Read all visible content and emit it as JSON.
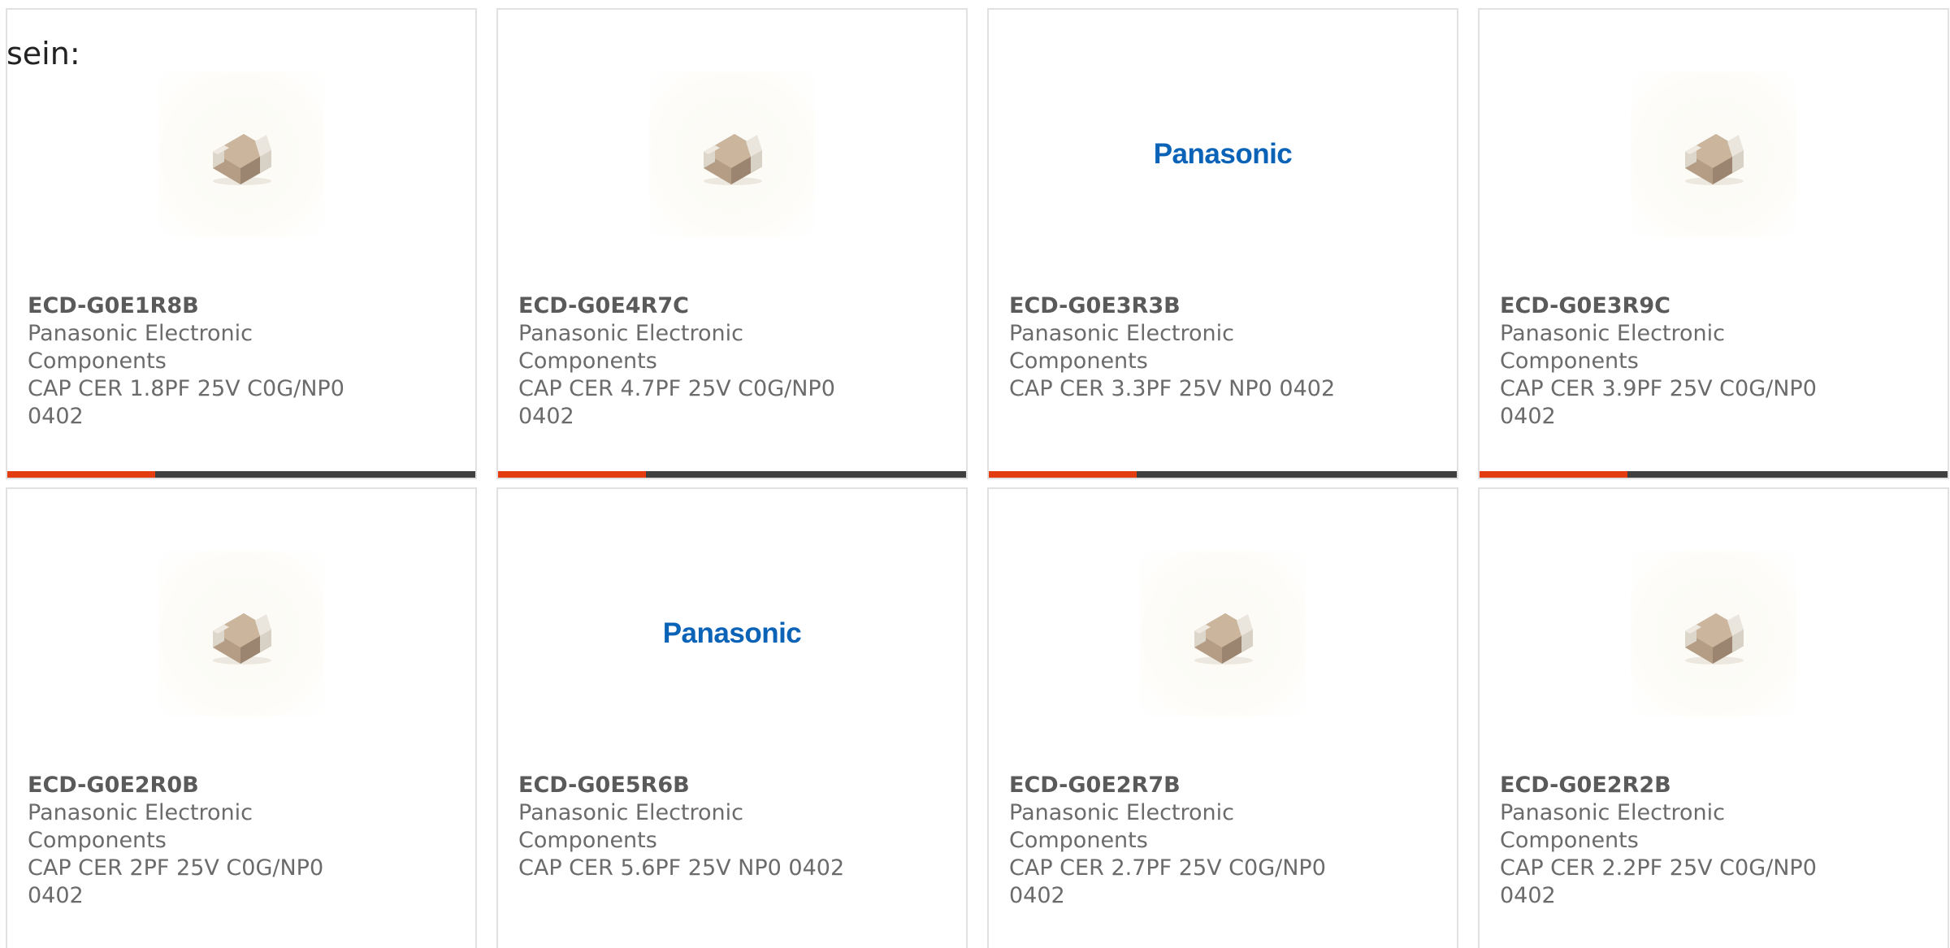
{
  "page": {
    "lead_text": "sein:"
  },
  "colors": {
    "accent": "#e33c10",
    "bar_dark": "#404040",
    "brand_blue": "#0a63b7",
    "text_gray": "#6b6b6b",
    "card_border": "#e1e1e1"
  },
  "products": [
    {
      "part_number": "ECD-G0E1R8B",
      "manufacturer": "Panasonic Electronic Components",
      "description": "CAP CER 1.8PF 25V C0G/NP0 0402",
      "image": "ceramic-capacitor-chip-icon"
    },
    {
      "part_number": "ECD-G0E4R7C",
      "manufacturer": "Panasonic Electronic Components",
      "description": "CAP CER 4.7PF 25V C0G/NP0 0402",
      "image": "ceramic-capacitor-chip-icon"
    },
    {
      "part_number": "ECD-G0E3R3B",
      "manufacturer": "Panasonic Electronic Components",
      "description": "CAP CER 3.3PF 25V NP0 0402",
      "image": "panasonic-logo",
      "logo_text": "Panasonic"
    },
    {
      "part_number": "ECD-G0E3R9C",
      "manufacturer": "Panasonic Electronic Components",
      "description": "CAP CER 3.9PF 25V C0G/NP0 0402",
      "image": "ceramic-capacitor-chip-icon"
    },
    {
      "part_number": "ECD-G0E2R0B",
      "manufacturer": "Panasonic Electronic Components",
      "description": "CAP CER 2PF 25V C0G/NP0 0402",
      "image": "ceramic-capacitor-chip-icon"
    },
    {
      "part_number": "ECD-G0E5R6B",
      "manufacturer": "Panasonic Electronic Components",
      "description": "CAP CER 5.6PF 25V NP0 0402",
      "image": "panasonic-logo",
      "logo_text": "Panasonic"
    },
    {
      "part_number": "ECD-G0E2R7B",
      "manufacturer": "Panasonic Electronic Components",
      "description": "CAP CER 2.7PF 25V C0G/NP0 0402",
      "image": "ceramic-capacitor-chip-icon"
    },
    {
      "part_number": "ECD-G0E2R2B",
      "manufacturer": "Panasonic Electronic Components",
      "description": "CAP CER 2.2PF 25V C0G/NP0 0402",
      "image": "ceramic-capacitor-chip-icon"
    }
  ]
}
